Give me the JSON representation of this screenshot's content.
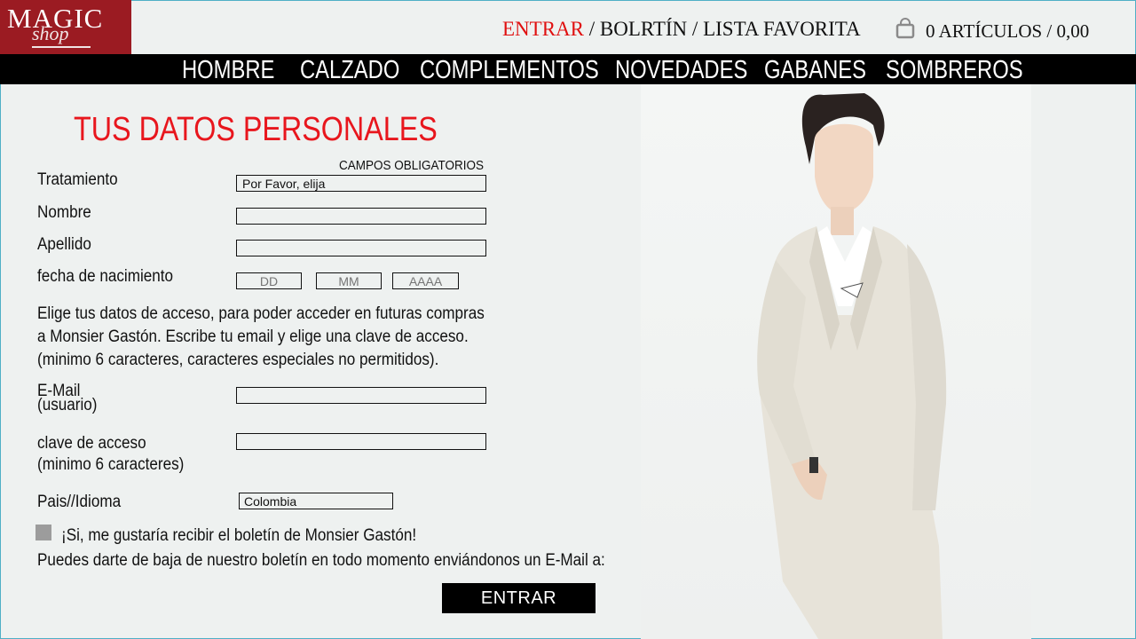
{
  "brand": {
    "line1": "MAGIC",
    "line2": "shop"
  },
  "topnav": {
    "login": "ENTRAR",
    "sep1": " / ",
    "newsletter": "BOLRTÍN",
    "sep2": " / ",
    "favorites": "LISTA FAVORITA",
    "cart": "0 ARTÍCULOS / 0,00"
  },
  "categories": [
    "HOMBRE",
    "CALZADO",
    "COMPLEMENTOS",
    "NOVEDADES",
    "GABANES",
    "SOMBREROS"
  ],
  "form": {
    "title": "TUS DATOS PERSONALES",
    "required_note": "CAMPOS OBLIGATORIOS",
    "treatment_label": "Tratamiento",
    "treatment_value": "Por Favor, elija",
    "name_label": "Nombre",
    "surname_label": "Apellido",
    "birth_label": "fecha de nacimiento",
    "dd": "DD",
    "mm": "MM",
    "yyyy": "AAAA",
    "access_line1": "Elige tus datos de acceso, para poder acceder en futuras compras",
    "access_line2": "a Monsier Gastón. Escribe tu email y elige una clave de acceso.",
    "access_line3": "(minimo 6 caracteres, caracteres especiales no permitidos).",
    "email_label_1": "E-Mail",
    "email_label_2": "(usuario)",
    "password_label_1": "clave de acceso",
    "password_label_2": "(minimo 6 caracteres)",
    "country_label": "Pais//Idioma",
    "country_value": "Colombia",
    "newsletter_checkbox": "¡Si, me gustaría recibir el boletín de Monsier Gastón!",
    "unsubscribe_note": "Puedes darte de baja de nuestro boletín en todo momento enviándonos un E-Mail a:",
    "submit_label": "ENTRAR"
  },
  "colors": {
    "brand": "#9b1b22",
    "accent": "#e8161d",
    "background": "#eef1f0"
  },
  "icons": {
    "cart": "shopping-bag-icon"
  }
}
